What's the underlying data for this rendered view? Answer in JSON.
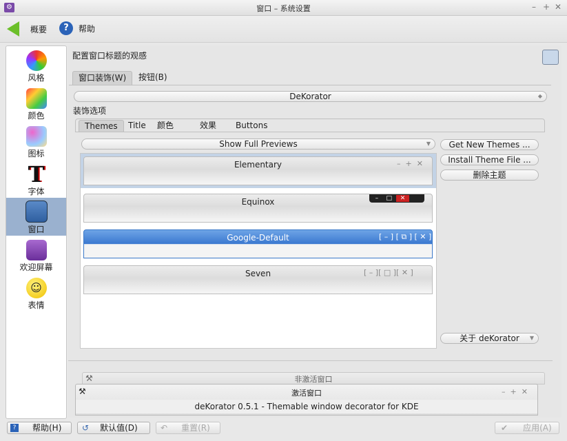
{
  "window": {
    "title": "窗口 – 系统设置"
  },
  "toolbar": {
    "overview": "概要",
    "help": "帮助"
  },
  "sidebar": {
    "items": [
      {
        "label": "风格",
        "icon": "paint-brush-icon"
      },
      {
        "label": "颜色",
        "icon": "color-palette-icon"
      },
      {
        "label": "图标",
        "icon": "icons-icon"
      },
      {
        "label": "字体",
        "icon": "font-icon"
      },
      {
        "label": "窗口",
        "icon": "window-icon",
        "active": true
      },
      {
        "label": "欢迎屏幕",
        "icon": "splash-screen-icon"
      },
      {
        "label": "表情",
        "icon": "smiley-icon"
      }
    ]
  },
  "main": {
    "header": "配置窗口标题的观感",
    "tabs": [
      "窗口装饰(W)",
      "按钮(B)"
    ],
    "decoration_select": "DeKorator",
    "options_label": "装饰选项",
    "subtabs": [
      "Themes",
      "Title",
      "颜色",
      "效果",
      "Buttons"
    ],
    "preview_select": "Show  Full  Previews",
    "themes": [
      "Elementary",
      "Equinox",
      "Google-Default",
      "Seven"
    ],
    "get_new": "Get  New  Themes  ...",
    "install": "Install  Theme  File  ...",
    "delete": "删除主题",
    "about": "关于  deKorator",
    "preview": {
      "inactive": "非激活窗口",
      "active": "激活窗口",
      "text": "deKorator  0.5.1  -  Themable  window  decorator  for  KDE"
    }
  },
  "footer": {
    "help": "帮助(H)",
    "defaults": "默认值(D)",
    "reset": "重置(R)",
    "apply": "应用(A)"
  }
}
